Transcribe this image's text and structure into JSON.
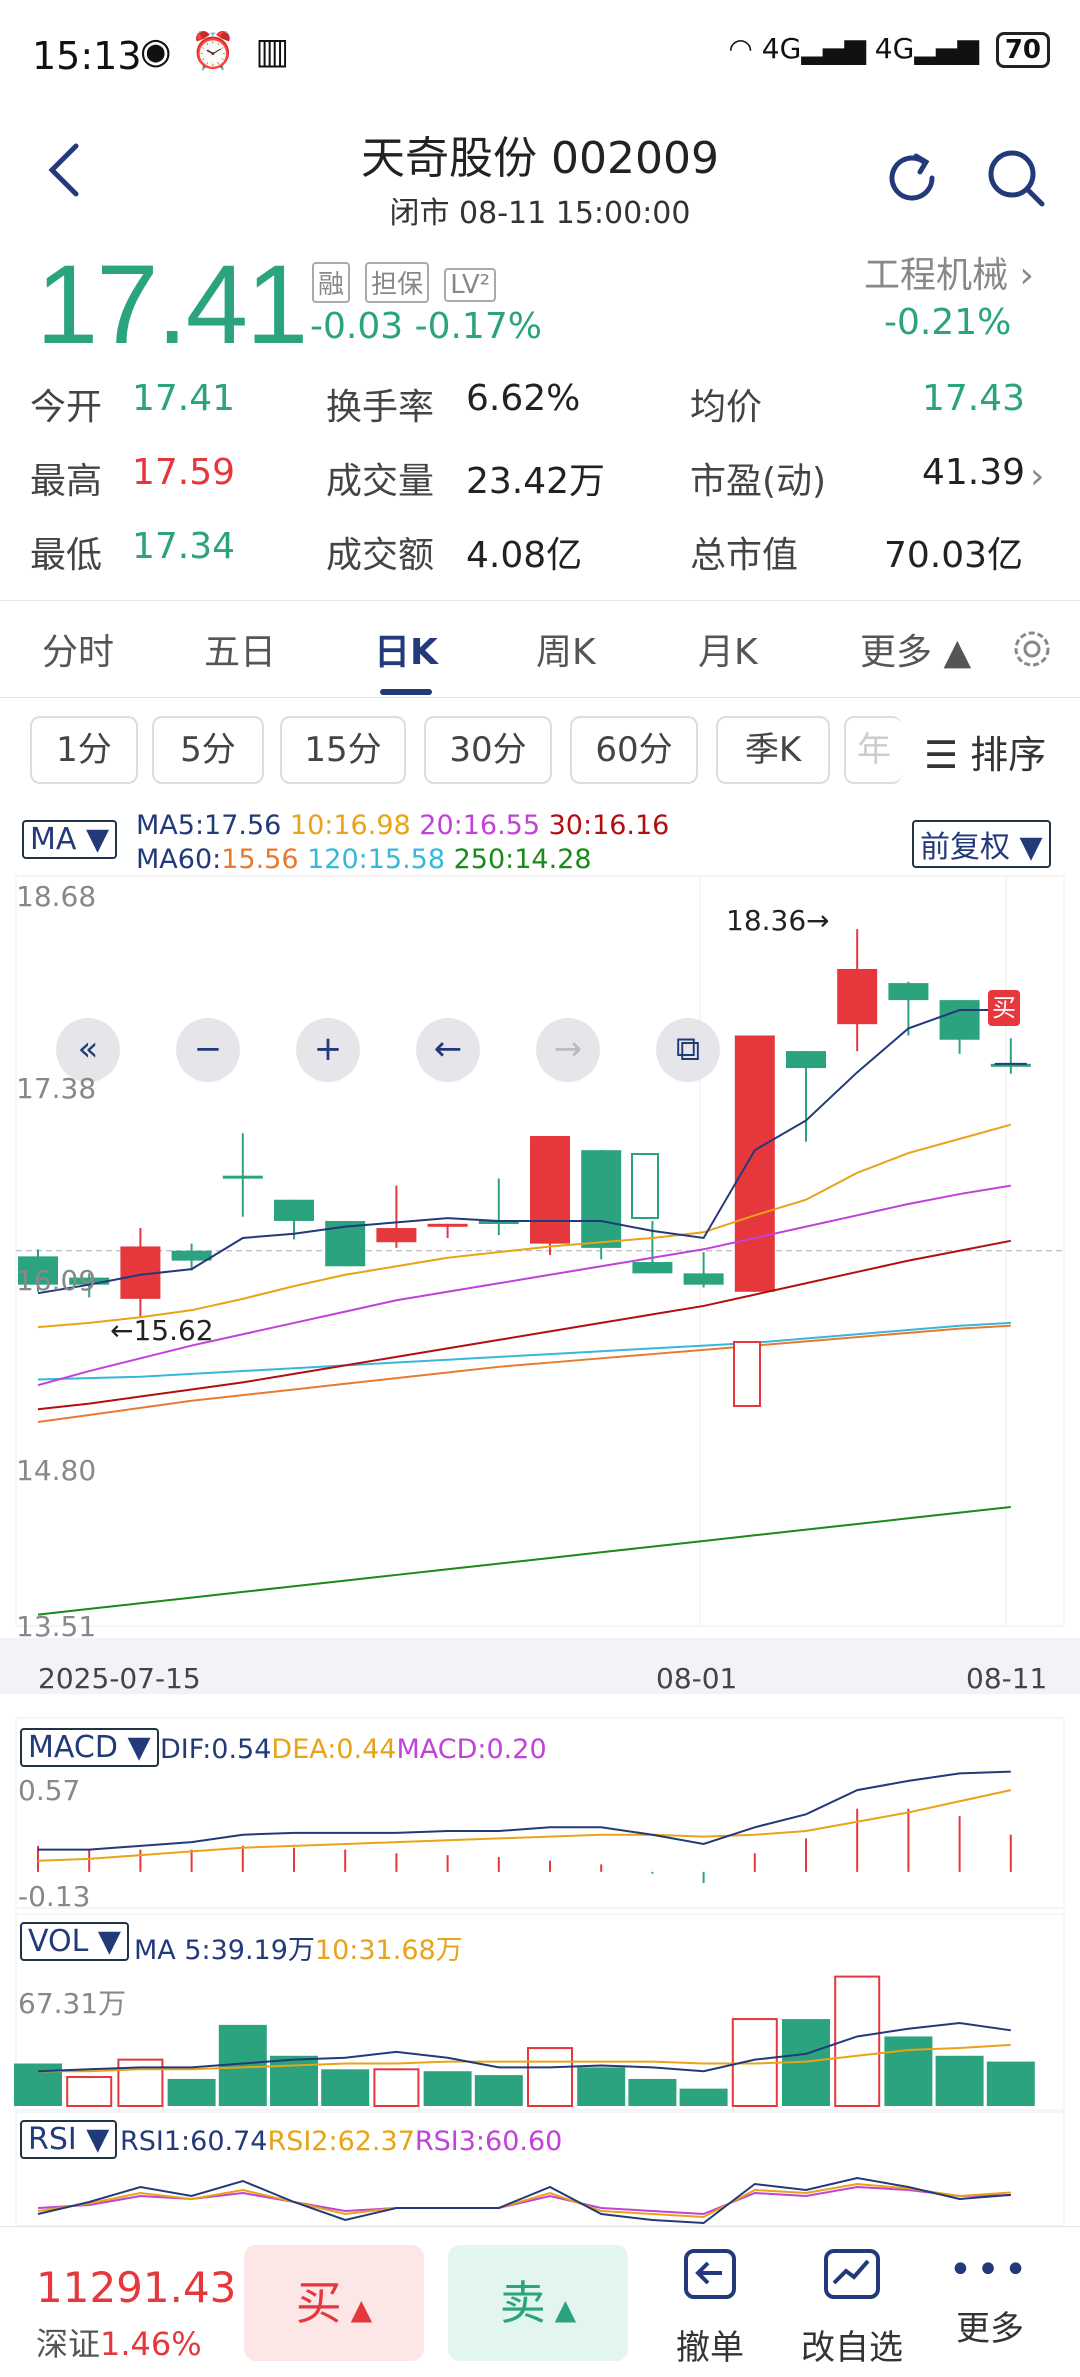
{
  "status": {
    "time": "15:13",
    "battery": "70",
    "net": "4G"
  },
  "header": {
    "title": "天奇股份 002009",
    "subtitle": "闭市 08-11 15:00:00"
  },
  "quote": {
    "price": "17.41",
    "change": "-0.03  -0.17%",
    "tags": [
      "融",
      "担保",
      "LV²"
    ],
    "industry": "工程机械 ›",
    "industry_change": "-0.21%"
  },
  "stats": [
    {
      "label": "今开",
      "value": "17.41"
    },
    {
      "label": "换手率",
      "value": "6.62%"
    },
    {
      "label": "均价",
      "value": "17.43"
    },
    {
      "label": "最高",
      "value": "17.59"
    },
    {
      "label": "成交量",
      "value": "23.42万"
    },
    {
      "label": "市盈(动)",
      "value": "41.39"
    },
    {
      "label": "最低",
      "value": "17.34"
    },
    {
      "label": "成交额",
      "value": "4.08亿"
    },
    {
      "label": "总市值",
      "value": "70.03亿"
    }
  ],
  "tabs": [
    "分时",
    "五日",
    "日K",
    "周K",
    "月K",
    "更多 ▲"
  ],
  "periods": [
    "1分",
    "5分",
    "15分",
    "30分",
    "60分",
    "季K",
    "年"
  ],
  "sort_label": "排序",
  "ma": {
    "selector": "MA ▼",
    "restore": "前复权 ▼",
    "line1": [
      {
        "text": "MA5:17.56 ",
        "color": "#223a7a"
      },
      {
        "text": "10:16.98 ",
        "color": "#e8a317"
      },
      {
        "text": "20:16.55 ",
        "color": "#c042d8"
      },
      {
        "text": "30:16.16",
        "color": "#b01010"
      }
    ],
    "line2": [
      {
        "text": "MA60:",
        "color": "#223a7a"
      },
      {
        "text": "15.56 ",
        "color": "#e87a30"
      },
      {
        "text": "120:15.58 ",
        "color": "#38b8d8"
      },
      {
        "text": "250:14.28",
        "color": "#1a8a1a"
      }
    ]
  },
  "kline_axis": {
    "y_labels": [
      "18.68",
      "17.38",
      "16.09",
      "14.80",
      "13.51"
    ],
    "x_labels": [
      "2025-07-15",
      "08-01",
      "08-11"
    ],
    "high_marker": "18.36→",
    "low_marker": "←15.62",
    "buy_tag": "买",
    "macd_tag": "MACD"
  },
  "macd": {
    "selector": "MACD ▼",
    "legend": [
      {
        "text": "DIF:0.54",
        "color": "#223a7a"
      },
      {
        "text": "DEA:0.44",
        "color": "#e8a317"
      },
      {
        "text": "MACD:0.20",
        "color": "#c042d8"
      }
    ],
    "y_labels": [
      "0.57",
      "-0.13"
    ]
  },
  "vol": {
    "selector": "VOL ▼",
    "legend": [
      {
        "text": "MA 5:39.19万",
        "color": "#223a7a"
      },
      {
        "text": "10:31.68万",
        "color": "#e8a317"
      }
    ],
    "y_label": "67.31万"
  },
  "rsi": {
    "selector": "RSI ▼",
    "legend": [
      {
        "text": "RSI1:60.74",
        "color": "#223a7a"
      },
      {
        "text": "RSI2:62.37",
        "color": "#e8a317"
      },
      {
        "text": "RSI3:60.60",
        "color": "#c042d8"
      }
    ]
  },
  "bottom": {
    "index_value": "11291.43",
    "index_label": "深证",
    "index_change": "1.46%",
    "buy": "买",
    "sell": "卖",
    "cancel": "撤单",
    "watch": "改自选",
    "more": "更多"
  },
  "chart_data": {
    "type": "candlestick",
    "candles": [
      {
        "o": 16.05,
        "c": 15.85,
        "h": 16.1,
        "l": 15.8
      },
      {
        "o": 15.9,
        "c": 15.85,
        "h": 15.93,
        "l": 15.76
      },
      {
        "o": 15.75,
        "c": 16.12,
        "h": 16.25,
        "l": 15.62
      },
      {
        "o": 16.09,
        "c": 16.02,
        "h": 16.14,
        "l": 15.95
      },
      {
        "o": 16.62,
        "c": 16.6,
        "h": 16.92,
        "l": 16.33
      },
      {
        "o": 16.45,
        "c": 16.3,
        "h": 16.45,
        "l": 16.17
      },
      {
        "o": 16.3,
        "c": 15.98,
        "h": 16.3,
        "l": 15.98
      },
      {
        "o": 16.15,
        "c": 16.25,
        "h": 16.55,
        "l": 16.11
      },
      {
        "o": 16.28,
        "c": 16.28,
        "h": 16.28,
        "l": 16.18
      },
      {
        "o": 16.3,
        "c": 16.3,
        "h": 16.6,
        "l": 16.2
      },
      {
        "o": 16.14,
        "c": 16.9,
        "h": 16.9,
        "l": 16.06
      },
      {
        "o": 16.8,
        "c": 16.11,
        "h": 16.8,
        "l": 16.03
      },
      {
        "o": 16.01,
        "c": 15.93,
        "h": 16.3,
        "l": 15.93
      },
      {
        "o": 15.93,
        "c": 15.85,
        "h": 16.08,
        "l": 15.83
      },
      {
        "o": 15.8,
        "c": 17.61,
        "h": 17.61,
        "l": 15.8
      },
      {
        "o": 17.5,
        "c": 17.38,
        "h": 17.5,
        "l": 16.86
      },
      {
        "o": 17.69,
        "c": 18.08,
        "h": 18.36,
        "l": 17.5
      },
      {
        "o": 17.98,
        "c": 17.86,
        "h": 17.99,
        "l": 17.61
      },
      {
        "o": 17.86,
        "c": 17.58,
        "h": 17.86,
        "l": 17.48
      },
      {
        "o": 17.41,
        "c": 17.41,
        "h": 17.59,
        "l": 17.34
      }
    ],
    "ma5": [
      15.79,
      15.85,
      15.92,
      15.96,
      16.18,
      16.21,
      16.26,
      16.29,
      16.32,
      16.3,
      16.3,
      16.3,
      16.23,
      16.18,
      16.8,
      17.01,
      17.35,
      17.66,
      17.79,
      17.79
    ],
    "ma10": [
      15.55,
      15.58,
      15.62,
      15.67,
      15.75,
      15.84,
      15.92,
      15.98,
      16.04,
      16.08,
      16.12,
      16.15,
      16.18,
      16.22,
      16.34,
      16.45,
      16.64,
      16.78,
      16.88,
      16.98
    ],
    "ma20": [
      15.14,
      15.24,
      15.33,
      15.42,
      15.5,
      15.58,
      15.66,
      15.74,
      15.8,
      15.86,
      15.92,
      15.98,
      16.04,
      16.1,
      16.18,
      16.26,
      16.34,
      16.42,
      16.49,
      16.55
    ],
    "ma30": [
      14.97,
      15.01,
      15.06,
      15.11,
      15.16,
      15.22,
      15.28,
      15.34,
      15.4,
      15.46,
      15.52,
      15.58,
      15.64,
      15.7,
      15.78,
      15.86,
      15.94,
      16.02,
      16.09,
      16.16
    ],
    "ma60": [
      14.88,
      14.93,
      14.98,
      15.03,
      15.07,
      15.11,
      15.15,
      15.19,
      15.23,
      15.27,
      15.3,
      15.33,
      15.36,
      15.39,
      15.42,
      15.45,
      15.48,
      15.51,
      15.54,
      15.56
    ],
    "ma120": [
      15.18,
      15.19,
      15.2,
      15.22,
      15.24,
      15.26,
      15.28,
      15.3,
      15.32,
      15.34,
      15.36,
      15.38,
      15.4,
      15.42,
      15.44,
      15.47,
      15.5,
      15.53,
      15.56,
      15.58
    ],
    "ma250": [
      13.52,
      13.56,
      13.6,
      13.64,
      13.68,
      13.72,
      13.76,
      13.8,
      13.84,
      13.88,
      13.92,
      13.96,
      14.0,
      14.04,
      14.08,
      14.12,
      14.16,
      14.2,
      14.24,
      14.28
    ],
    "ylim": [
      13.51,
      18.68
    ],
    "macd": {
      "dif": [
        0.12,
        0.12,
        0.14,
        0.16,
        0.2,
        0.21,
        0.21,
        0.21,
        0.22,
        0.22,
        0.24,
        0.24,
        0.2,
        0.15,
        0.24,
        0.31,
        0.44,
        0.49,
        0.53,
        0.54
      ],
      "dea": [
        0.06,
        0.07,
        0.09,
        0.11,
        0.13,
        0.14,
        0.15,
        0.16,
        0.17,
        0.18,
        0.19,
        0.2,
        0.2,
        0.19,
        0.2,
        0.22,
        0.27,
        0.32,
        0.38,
        0.44
      ],
      "hist": [
        0.14,
        0.12,
        0.12,
        0.12,
        0.14,
        0.13,
        0.12,
        0.1,
        0.09,
        0.08,
        0.06,
        0.04,
        -0.01,
        -0.06,
        0.1,
        0.18,
        0.34,
        0.34,
        0.3,
        0.2
      ],
      "ylim": [
        -0.13,
        0.57
      ]
    },
    "volume": {
      "values": [
        22,
        15,
        24,
        14,
        42,
        26,
        19,
        19,
        18,
        16,
        30,
        20,
        14,
        9,
        45,
        45,
        67,
        36,
        26,
        23
      ],
      "up": [
        false,
        true,
        true,
        false,
        false,
        false,
        false,
        true,
        false,
        false,
        true,
        false,
        false,
        false,
        true,
        false,
        true,
        false,
        false,
        false
      ],
      "ma5": [
        18,
        19,
        20,
        20,
        22,
        24,
        25,
        28,
        25,
        20,
        20,
        21,
        20,
        18,
        24,
        27,
        36,
        40,
        43,
        39.19
      ],
      "ma10": [
        18,
        18,
        19,
        19,
        20,
        21,
        22,
        22,
        23,
        23,
        23,
        23,
        23,
        22,
        22,
        23,
        26,
        29,
        30,
        31.68
      ],
      "ymax": 67.31
    },
    "rsi": {
      "rsi1": [
        48,
        56,
        66,
        60,
        70,
        56,
        44,
        52,
        52,
        52,
        66,
        48,
        44,
        42,
        68,
        64,
        72,
        66,
        58,
        60.74
      ],
      "rsi2": [
        50,
        55,
        62,
        58,
        64,
        56,
        48,
        52,
        52,
        52,
        62,
        50,
        48,
        46,
        64,
        62,
        68,
        65,
        60,
        62.37
      ],
      "rsi3": [
        52,
        54,
        60,
        58,
        62,
        56,
        50,
        52,
        52,
        52,
        60,
        52,
        50,
        48,
        62,
        60,
        66,
        64,
        60,
        60.6
      ]
    }
  }
}
